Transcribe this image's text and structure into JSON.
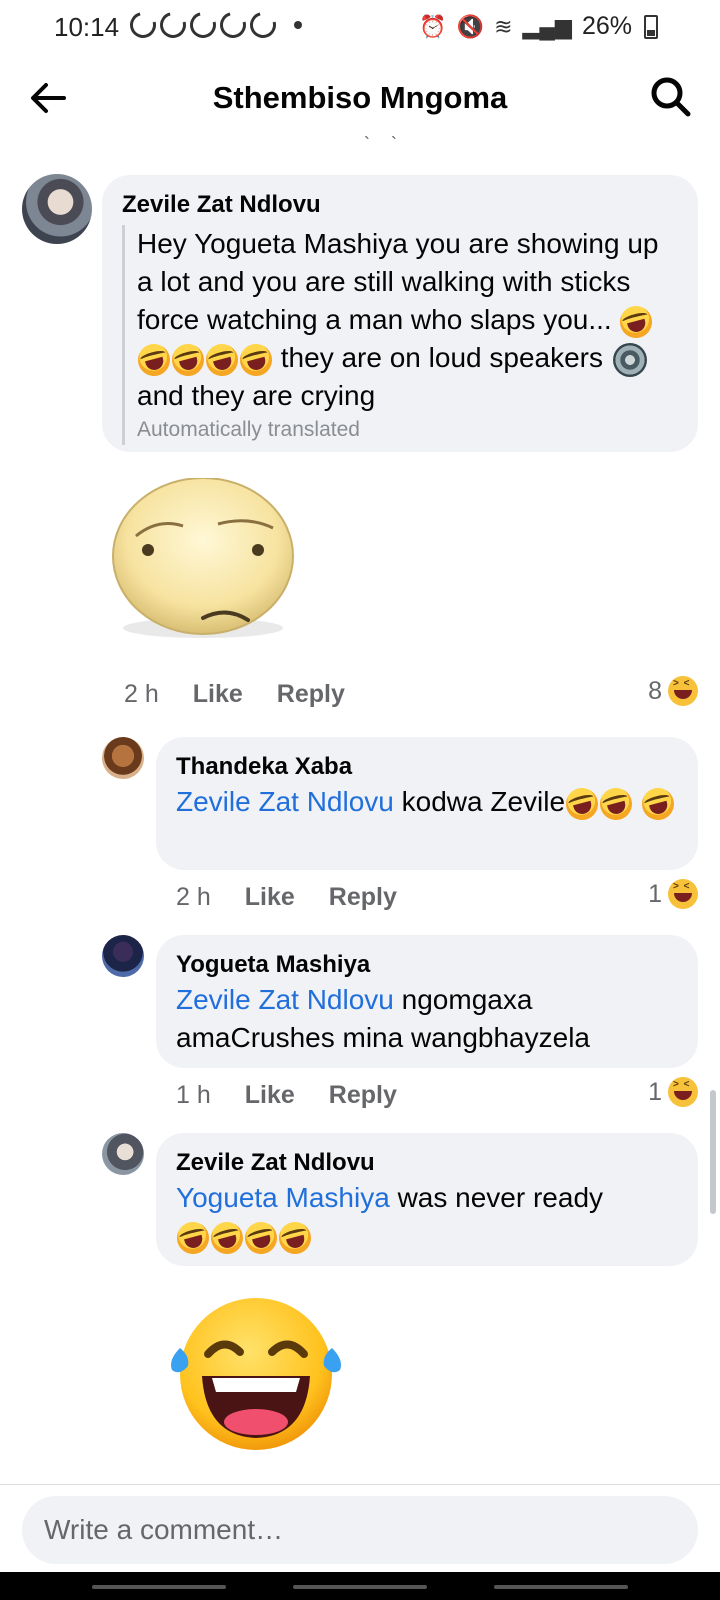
{
  "status_bar": {
    "time": "10:14",
    "battery": "26%"
  },
  "header": {
    "title": "Sthembiso Mngoma"
  },
  "comments": [
    {
      "author": "Zevile Zat Ndlovu",
      "text_parts": [
        "Hey Yogueta Mashiya you are showing up a lot and you are still walking with sticks force watching a man who slaps you...",
        "they are on loud speakers",
        "and they are crying"
      ],
      "translated_label": "Automatically translated",
      "time": "2 h",
      "like": "Like",
      "reply": "Reply",
      "reaction_count": "8"
    }
  ],
  "replies": [
    {
      "author": "Thandeka Xaba",
      "mention": "Zevile Zat Ndlovu",
      "text": "kodwa Zevile",
      "time": "2 h",
      "like": "Like",
      "reply": "Reply",
      "reaction_count": "1"
    },
    {
      "author": "Yogueta Mashiya",
      "mention": "Zevile Zat Ndlovu",
      "text": "ngomgaxa amaCrushes mina wangbhayzela",
      "time": "1 h",
      "like": "Like",
      "reply": "Reply",
      "reaction_count": "1"
    },
    {
      "author": "Zevile Zat Ndlovu",
      "mention": "Yogueta Mashiya",
      "text": "was never ready"
    }
  ],
  "composer": {
    "placeholder": "Write a comment…"
  },
  "colors": {
    "mention": "#216fdb",
    "bubble": "#f0f2f5",
    "meta": "#65676b"
  },
  "icons": [
    "back-arrow-icon",
    "search-icon",
    "haha-reaction-icon",
    "rolling-laughing-emoji",
    "speaker-emoji",
    "worried-face-sticker",
    "tears-of-joy-sticker"
  ]
}
